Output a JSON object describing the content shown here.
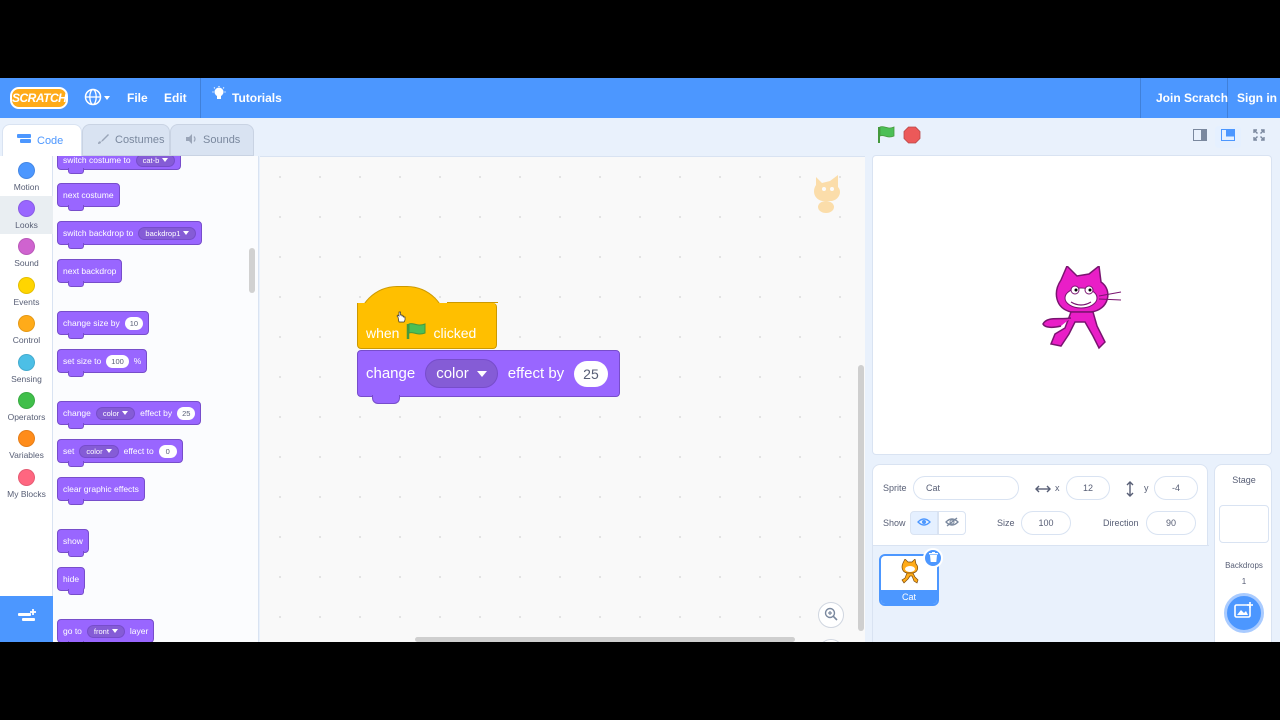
{
  "menubar": {
    "logo": "SCRATCH",
    "file": "File",
    "edit": "Edit",
    "tutorials": "Tutorials",
    "join": "Join Scratch",
    "signin": "Sign in"
  },
  "tabs": {
    "code": "Code",
    "costumes": "Costumes",
    "sounds": "Sounds"
  },
  "categories": [
    {
      "label": "Motion",
      "color": "#4c97ff"
    },
    {
      "label": "Looks",
      "color": "#9966ff"
    },
    {
      "label": "Sound",
      "color": "#cf63cf"
    },
    {
      "label": "Events",
      "color": "#ffd500"
    },
    {
      "label": "Control",
      "color": "#ffab19"
    },
    {
      "label": "Sensing",
      "color": "#4cbfe6"
    },
    {
      "label": "Operators",
      "color": "#40bf4a"
    },
    {
      "label": "Variables",
      "color": "#ff8c1a"
    },
    {
      "label": "My Blocks",
      "color": "#ff6680"
    }
  ],
  "palette": {
    "switch_costume": {
      "label": "switch costume to",
      "value": "cat-b"
    },
    "next_costume": "next costume",
    "switch_backdrop": {
      "label": "switch backdrop to",
      "value": "backdrop1"
    },
    "next_backdrop": "next backdrop",
    "change_size": {
      "label": "change size by",
      "value": "10"
    },
    "set_size": {
      "label": "set size to",
      "value": "100",
      "suffix": "%"
    },
    "change_effect": {
      "label": "change",
      "effect": "color",
      "label2": "effect by",
      "value": "25"
    },
    "set_effect": {
      "label": "set",
      "effect": "color",
      "label2": "effect to",
      "value": "0"
    },
    "clear_effects": "clear graphic effects",
    "show": "show",
    "hide": "hide",
    "go_to_layer": {
      "label": "go to",
      "value": "front",
      "label2": "layer"
    }
  },
  "script": {
    "hat": {
      "when": "when",
      "clicked": "clicked"
    },
    "change": {
      "label": "change",
      "effect": "color",
      "label2": "effect by",
      "value": "25"
    }
  },
  "zoom": {
    "in": "+",
    "out": "−",
    "reset": "="
  },
  "sprite_info": {
    "sprite_label": "Sprite",
    "sprite_name": "Cat",
    "x_label": "x",
    "x_value": "12",
    "y_label": "y",
    "y_value": "-4",
    "show_label": "Show",
    "size_label": "Size",
    "size_value": "100",
    "direction_label": "Direction",
    "direction_value": "90"
  },
  "sprites": [
    {
      "name": "Cat"
    }
  ],
  "stage_pane": {
    "title": "Stage",
    "backdrops_label": "Backdrops",
    "backdrops_count": "1"
  },
  "colors": {
    "menu_blue": "#4c97ff",
    "looks_purple": "#9966ff",
    "events_yellow": "#ffbf00"
  }
}
